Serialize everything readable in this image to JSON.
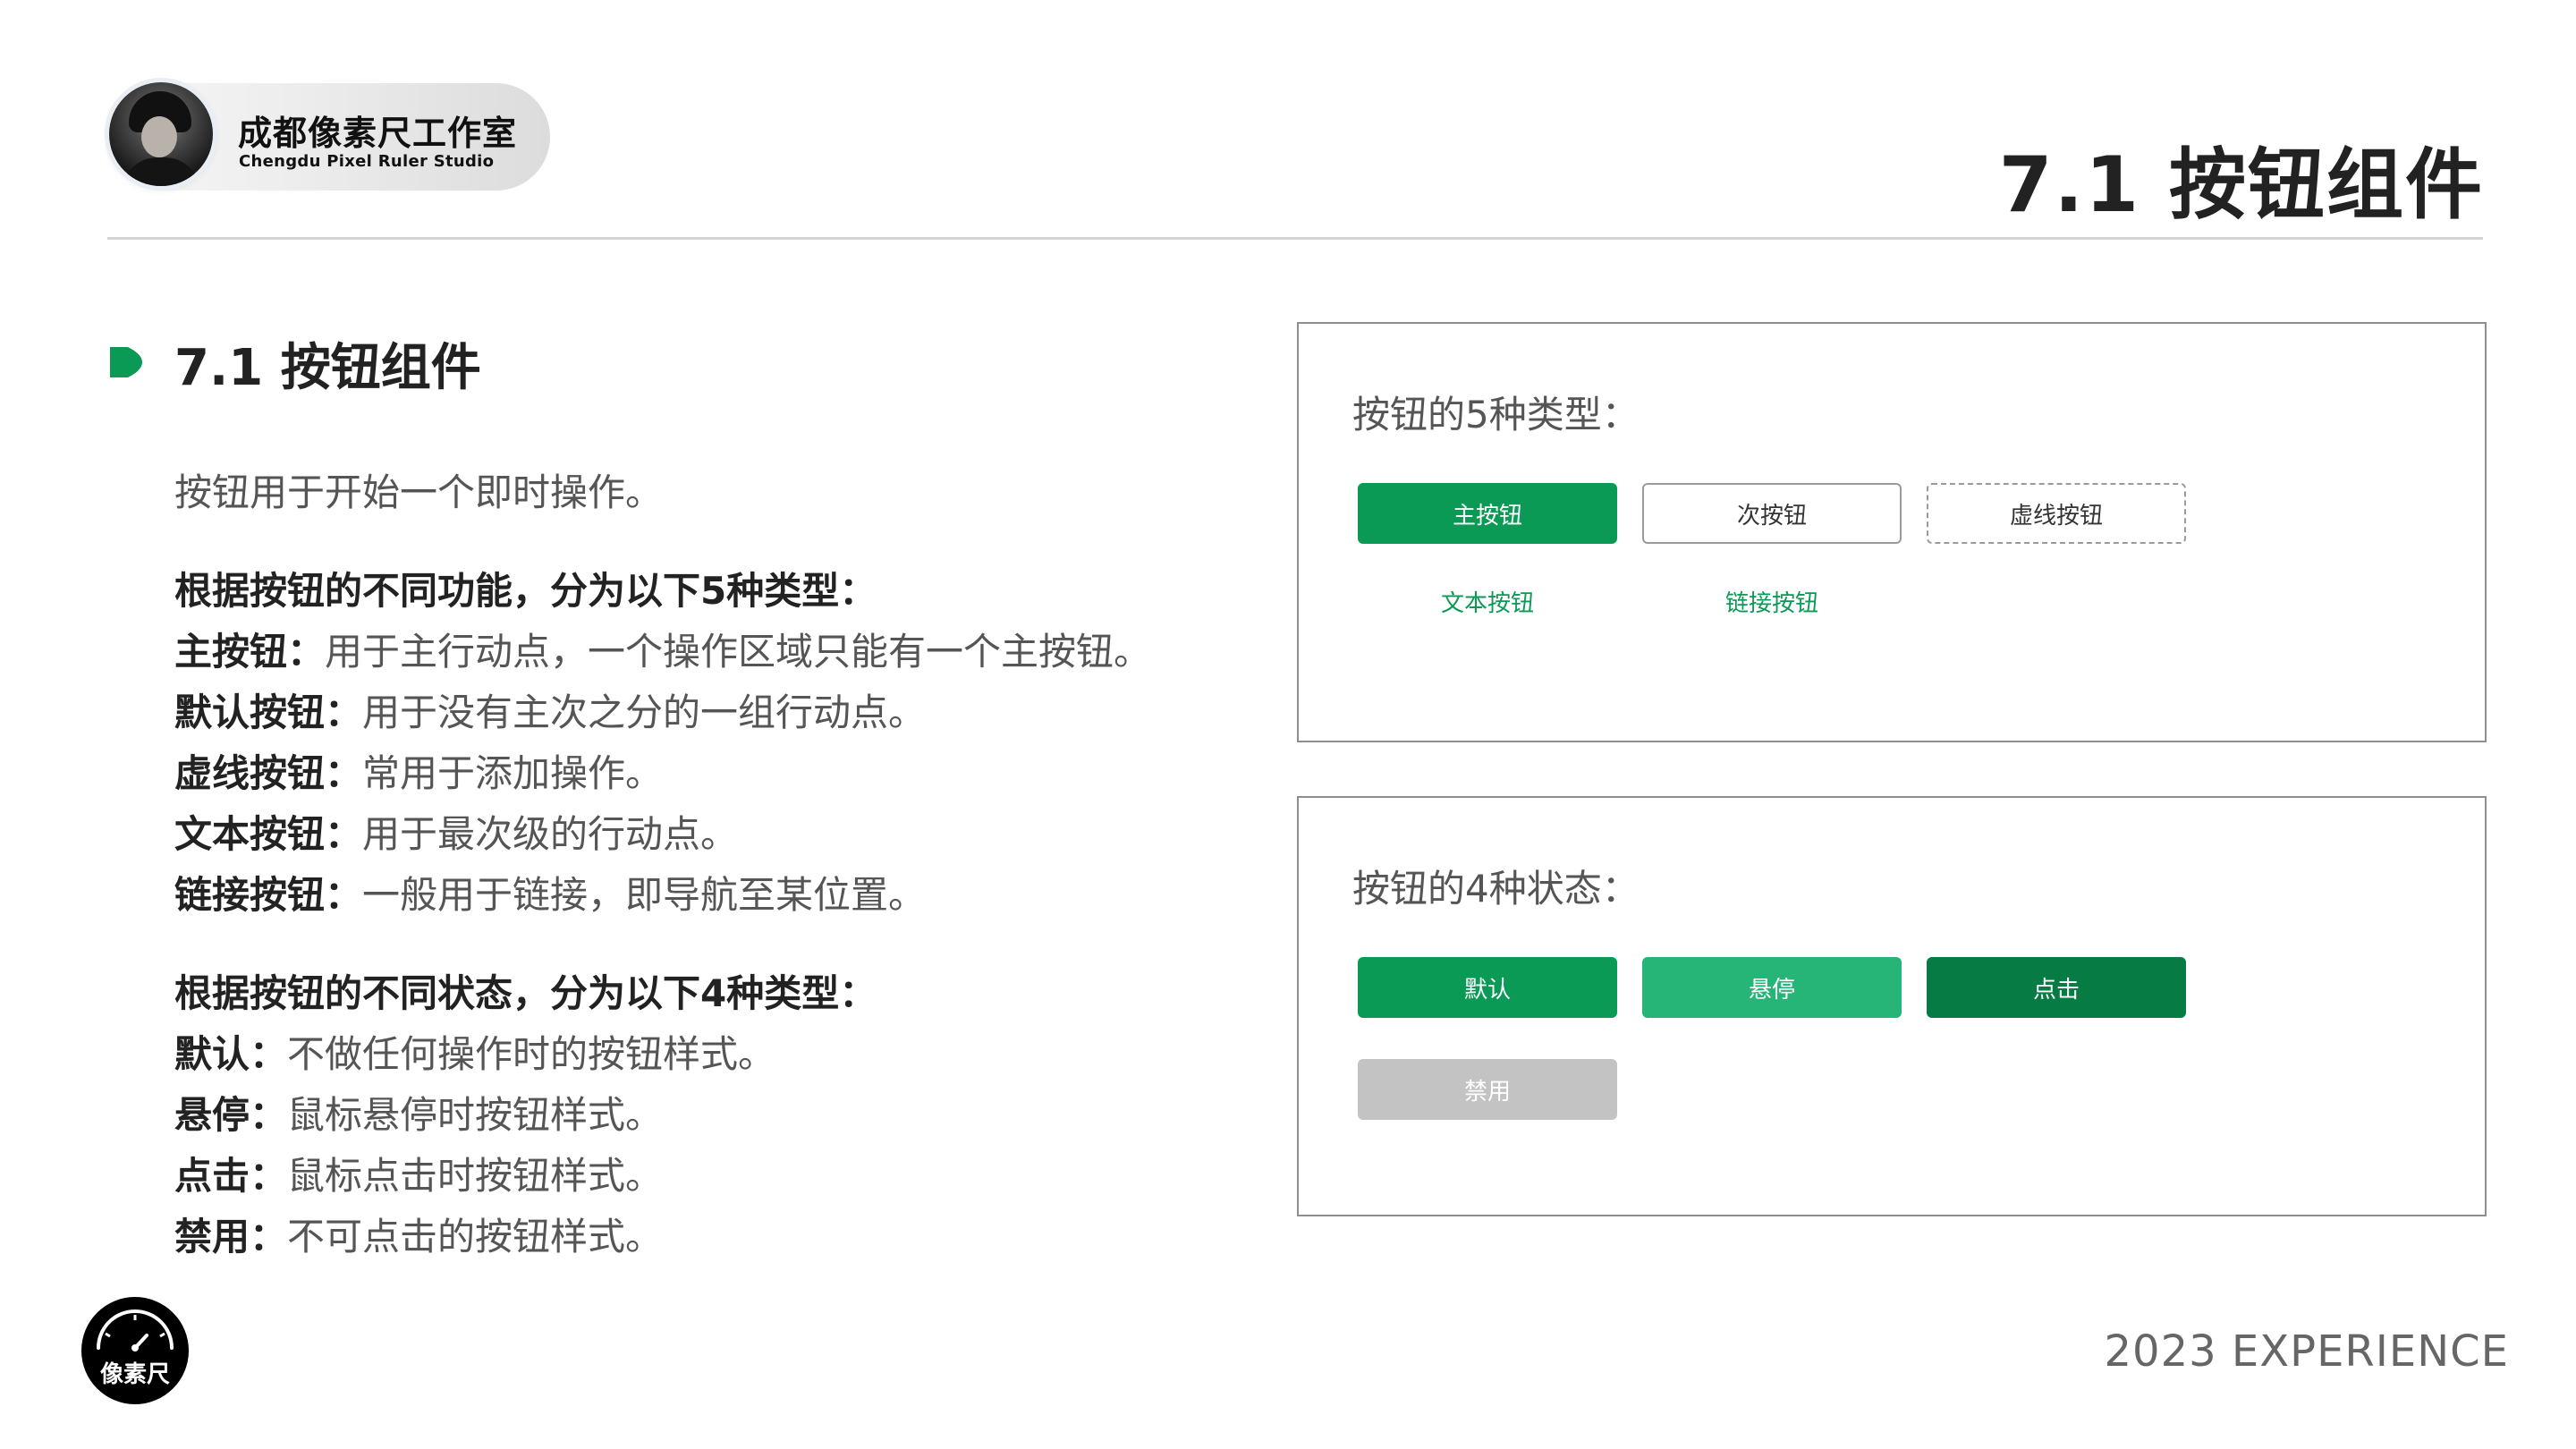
{
  "header": {
    "studio_name": "成都像素尺工作室",
    "studio_en": "Chengdu Pixel Ruler Studio",
    "title": "7.1 按钮组件"
  },
  "section": {
    "title": "7.1  按钮组件",
    "intro": "按钮用于开始一个即时操作。",
    "types_heading": "根据按钮的不同功能，分为以下5种类型：",
    "types": [
      {
        "label": "主按钮：",
        "desc": "用于主行动点，一个操作区域只能有一个主按钮。"
      },
      {
        "label": "默认按钮：",
        "desc": "用于没有主次之分的一组行动点。"
      },
      {
        "label": "虚线按钮：",
        "desc": "常用于添加操作。"
      },
      {
        "label": "文本按钮：",
        "desc": "用于最次级的行动点。"
      },
      {
        "label": "链接按钮：",
        "desc": "一般用于链接，即导航至某位置。"
      }
    ],
    "states_heading": "根据按钮的不同状态，分为以下4种类型：",
    "states": [
      {
        "label": "默认：",
        "desc": "不做任何操作时的按钮样式。"
      },
      {
        "label": "悬停：",
        "desc": "鼠标悬停时按钮样式。"
      },
      {
        "label": "点击：",
        "desc": "鼠标点击时按钮样式。"
      },
      {
        "label": "禁用：",
        "desc": "不可点击的按钮样式。"
      }
    ]
  },
  "card_types": {
    "title": "按钮的5种类型：",
    "buttons": {
      "primary": "主按钮",
      "secondary": "次按钮",
      "dashed": "虚线按钮",
      "text": "文本按钮",
      "link": "链接按钮"
    }
  },
  "card_states": {
    "title": "按钮的4种状态：",
    "buttons": {
      "default": "默认",
      "hover": "悬停",
      "active": "点击",
      "disabled": "禁用"
    }
  },
  "footer": {
    "logo_text": "像素尺",
    "text": "2023  EXPERIENCE"
  },
  "colors": {
    "primary": "#0a9a56",
    "hover": "#27b577",
    "active": "#067b43",
    "disabled": "#c3c3c3"
  }
}
